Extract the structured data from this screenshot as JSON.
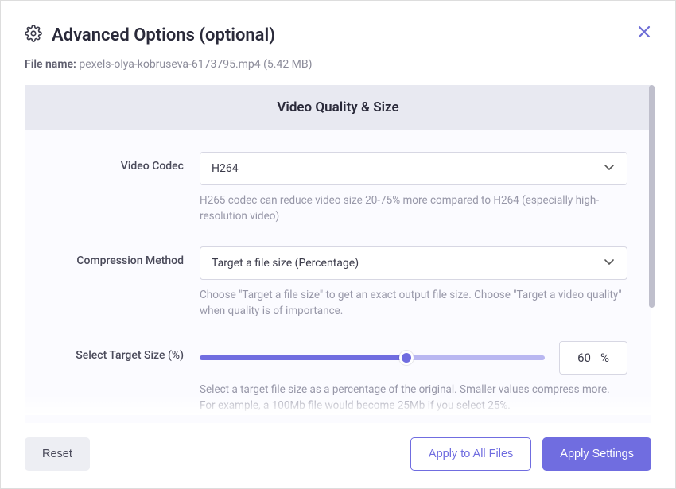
{
  "header": {
    "title": "Advanced Options (optional)"
  },
  "file": {
    "label": "File name:",
    "name": "pexels-olya-kobruseva-6173795.mp4 (5.42 MB)"
  },
  "section": {
    "title": "Video Quality & Size"
  },
  "codec": {
    "label": "Video Codec",
    "value": "H264",
    "helper": "H265 codec can reduce video size 20-75% more compared to H264 (especially high-resolution video)"
  },
  "method": {
    "label": "Compression Method",
    "value": "Target a file size (Percentage)",
    "helper": "Choose \"Target a file size\" to get an exact output file size. Choose \"Target a video quality\" when quality is of importance."
  },
  "target": {
    "label": "Select Target Size (%)",
    "value": "60",
    "unit": "%",
    "helper": "Select a target file size as a percentage of the original. Smaller values compress more. For example, a 100Mb file would become 25Mb if you select 25%."
  },
  "footer": {
    "reset": "Reset",
    "applyAll": "Apply to All Files",
    "apply": "Apply Settings"
  }
}
